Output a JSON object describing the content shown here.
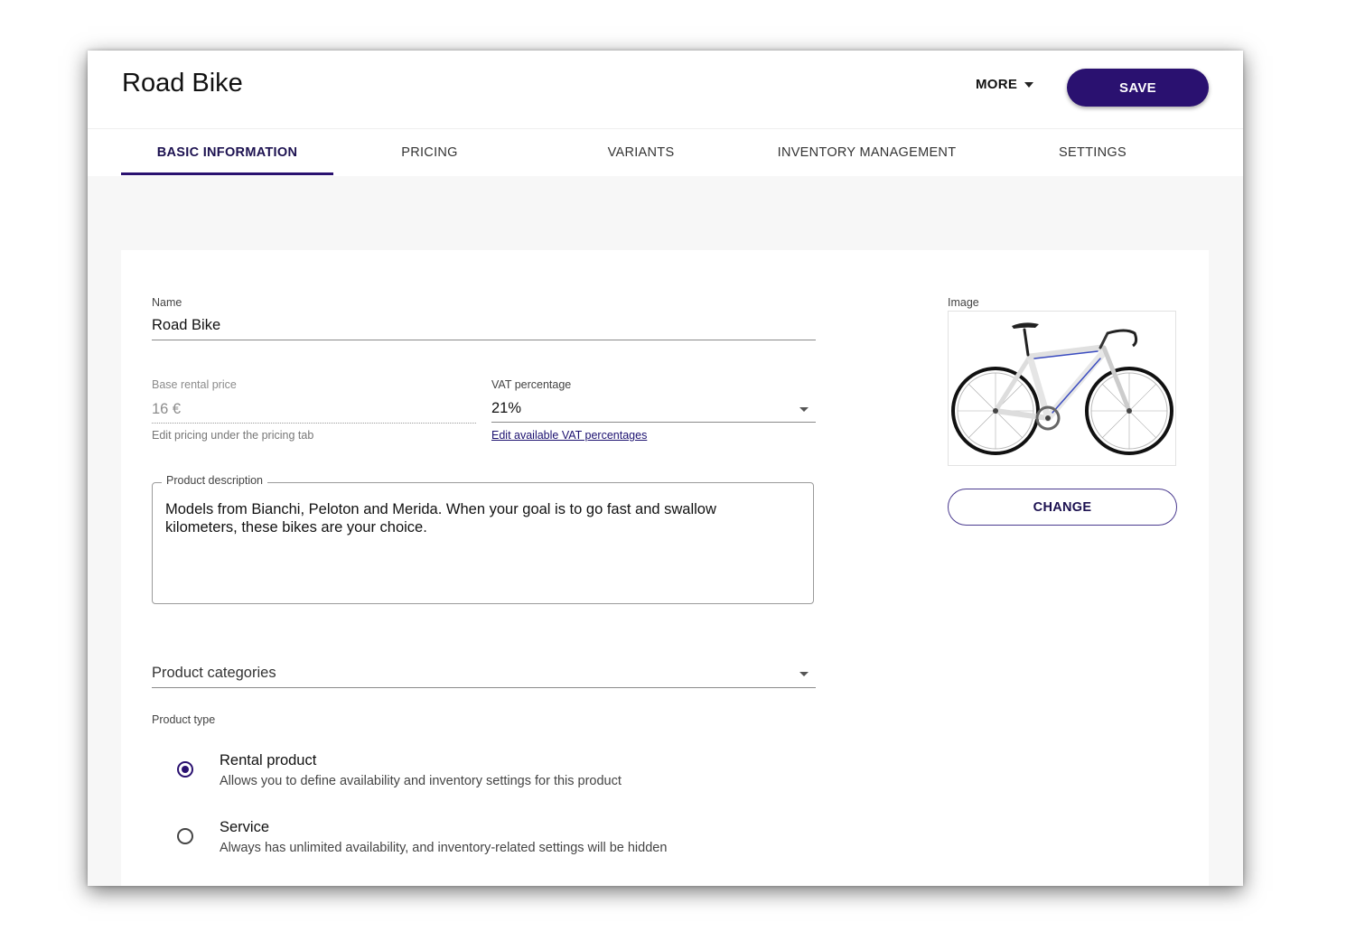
{
  "header": {
    "title": "Road Bike",
    "more_label": "MORE",
    "save_label": "SAVE"
  },
  "tabs": [
    {
      "label": "BASIC INFORMATION",
      "active": true
    },
    {
      "label": "PRICING",
      "active": false
    },
    {
      "label": "VARIANTS",
      "active": false
    },
    {
      "label": "INVENTORY MANAGEMENT",
      "active": false
    },
    {
      "label": "SETTINGS",
      "active": false
    }
  ],
  "form": {
    "name": {
      "label": "Name",
      "value": "Road Bike"
    },
    "base_price": {
      "label": "Base rental price",
      "value": "16 €",
      "helper": "Edit pricing under the pricing tab"
    },
    "vat": {
      "label": "VAT percentage",
      "value": "21%",
      "link": "Edit available VAT percentages"
    },
    "description": {
      "label": "Product description",
      "value": "Models from Bianchi, Peloton and Merida. When your goal is to go fast and swallow kilometers, these bikes are your choice."
    },
    "categories": {
      "placeholder": "Product categories"
    },
    "product_type": {
      "label": "Product type",
      "options": [
        {
          "title": "Rental product",
          "description": "Allows you to define availability and inventory settings for this product",
          "selected": true
        },
        {
          "title": "Service",
          "description": "Always has unlimited availability, and inventory-related settings will be hidden",
          "selected": false
        }
      ]
    }
  },
  "image": {
    "label": "Image",
    "change_label": "CHANGE"
  },
  "colors": {
    "accent": "#2a1170",
    "background": "#f7f7f7",
    "card": "#ffffff"
  },
  "icons": {
    "more_caret": "caret-down-icon",
    "dropdown": "chevron-down-icon"
  }
}
